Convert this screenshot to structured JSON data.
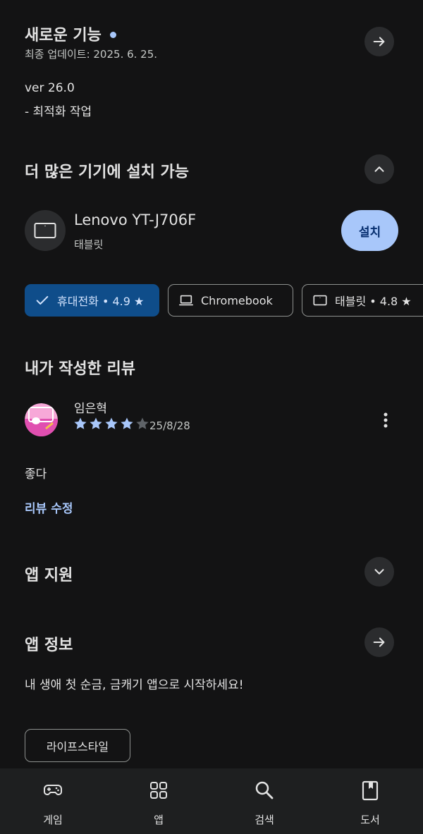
{
  "whats_new": {
    "title": "새로운 기능",
    "updated": "최종 업데이트: 2025. 6. 25.",
    "version": "ver 26.0",
    "notes": "- 최적화 작업"
  },
  "devices": {
    "title": "더 많은 기기에 설치 가능",
    "device_name": "Lenovo YT-J706F",
    "device_type": "태블릿",
    "install_label": "설치"
  },
  "rating_chips": [
    {
      "label": "휴대전화 • 4.9 ★",
      "icon": "check-icon",
      "selected": true
    },
    {
      "label": "Chromebook",
      "icon": "laptop-icon",
      "selected": false
    },
    {
      "label": "태블릿 • 4.8 ★",
      "icon": "tablet-icon",
      "selected": false
    }
  ],
  "my_review": {
    "title": "내가 작성한 리뷰",
    "author": "임은혁",
    "stars": 4,
    "max_stars": 5,
    "date": "25/8/28",
    "text": "좋다",
    "edit_label": "리뷰 수정"
  },
  "app_support": {
    "title": "앱 지원"
  },
  "app_info": {
    "title": "앱 정보",
    "description": "내 생애 첫 순금, 금캐기 앱으로 시작하세요!",
    "tag": "라이프스타일"
  },
  "bottom_nav": [
    {
      "label": "게임",
      "icon": "gamepad-icon"
    },
    {
      "label": "앱",
      "icon": "apps-grid-icon"
    },
    {
      "label": "검색",
      "icon": "search-icon"
    },
    {
      "label": "도서",
      "icon": "book-icon"
    }
  ],
  "colors": {
    "background": "#131314",
    "accent": "#a8c7fa",
    "selected_chip": "#0f4d8a"
  }
}
